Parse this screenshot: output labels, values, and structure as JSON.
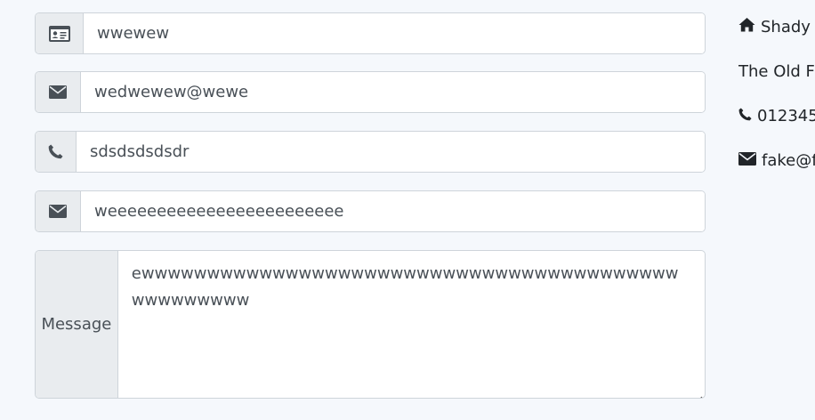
{
  "form": {
    "name_value": "wwewew",
    "email_value": "wedwewew@wewe",
    "phone_value": "sdsdsdsdsdr",
    "subject_value": "weeeeeeeeeeeeeeeeeeeeeeee",
    "message_label": "Message",
    "message_value": "ewwwwwwwwwwwwwwwwwwwwwwwwwwwwwwwwwwwwwwwwwwwwwwwwww"
  },
  "contact": {
    "address_line1": "Shady I",
    "address_line2": "The Old F",
    "phone": "012345",
    "email": "fake@f"
  },
  "icons": {
    "name": "id-card-icon",
    "email": "envelope-icon",
    "phone": "phone-icon",
    "subject": "envelope-icon",
    "home": "home-icon"
  },
  "colors": {
    "page_bg": "#f5f8fc",
    "addon_bg": "#e9ecef",
    "border": "#ced4da",
    "text": "#495057",
    "icon": "#495057"
  }
}
